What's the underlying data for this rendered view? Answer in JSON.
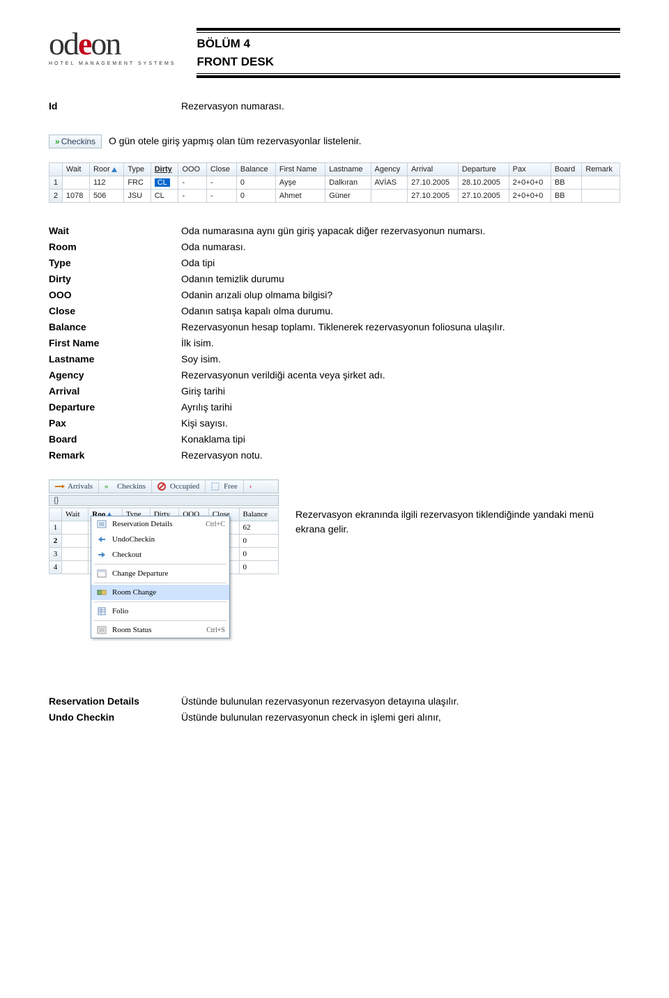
{
  "header": {
    "logo_main_pre": "od",
    "logo_main_accent": "e",
    "logo_main_post": "on",
    "logo_sub": "Hotel Management Systems",
    "section_line1": "BÖLÜM 4",
    "section_line2": "FRONT DESK"
  },
  "intro": {
    "id_term": "Id",
    "id_desc": "Rezervasyon numarası.",
    "checkins_label": "Checkins",
    "checkins_desc": "O gün otele giriş yapmış olan tüm rezervasyonlar listelenir."
  },
  "grid1": {
    "headers": [
      "",
      "Wait",
      "Roor",
      "Type",
      "Dirty",
      "OOO",
      "Close",
      "Balance",
      "First Name",
      "Lastname",
      "Agency",
      "Arrival",
      "Departure",
      "Pax",
      "Board",
      "Remark"
    ],
    "rows": [
      [
        "1",
        "",
        "112",
        "FRC",
        "CL",
        "-",
        "-",
        "0",
        "Ayşe",
        "Dalkıran",
        "AVİAS",
        "27.10.2005",
        "28.10.2005",
        "2+0+0+0",
        "BB",
        ""
      ],
      [
        "2",
        "1078",
        "506",
        "JSU",
        "CL",
        "-",
        "-",
        "0",
        "Ahmet",
        "Güner",
        "",
        "27.10.2005",
        "27.10.2005",
        "2+0+0+0",
        "BB",
        ""
      ]
    ]
  },
  "defs": [
    {
      "t": "Wait",
      "d": "Oda numarasına aynı gün giriş yapacak diğer rezervasyonun numarsı."
    },
    {
      "t": "Room",
      "d": "Oda numarası."
    },
    {
      "t": "Type",
      "d": "Oda tipi"
    },
    {
      "t": "Dirty",
      "d": "Odanın temizlik durumu"
    },
    {
      "t": "OOO",
      "d": "Odanin arızali olup olmama bilgisi?"
    },
    {
      "t": "Close",
      "d": "Odanın satışa kapalı olma durumu."
    },
    {
      "t": "Balance",
      "d": "Rezervasyonun hesap toplamı. Tiklenerek rezervasyonun foliosuna ulaşılır."
    },
    {
      "t": "First Name",
      "d": "İlk isim."
    },
    {
      "t": "Lastname",
      "d": "Soy isim."
    },
    {
      "t": "Agency",
      "d": "Rezervasyonun verildiği acenta veya şirket adı."
    },
    {
      "t": "Arrival",
      "d": "Giriş tarihi"
    },
    {
      "t": "Departure",
      "d": "Ayrılış tarihi"
    },
    {
      "t": "Pax",
      "d": "Kişi sayısı."
    },
    {
      "t": "Board",
      "d": "Konaklama tipi"
    },
    {
      "t": "Remark",
      "d": "Rezervasyon notu."
    }
  ],
  "toolbar": {
    "items": [
      "Arrivals",
      "Checkins",
      "Occupied",
      "Free"
    ]
  },
  "grid2": {
    "headers": [
      "",
      "Wait",
      "Roo",
      "Type",
      "Dirty",
      "OOO",
      "Close",
      "Balance"
    ],
    "rows": [
      [
        "1",
        "",
        "",
        "",
        "",
        "",
        "",
        "62"
      ],
      [
        "2",
        "",
        "",
        "",
        "",
        "",
        "",
        "0"
      ],
      [
        "3",
        "",
        "",
        "",
        "",
        "",
        "",
        "0"
      ],
      [
        "4",
        "",
        "",
        "",
        "",
        "",
        "",
        "0"
      ]
    ]
  },
  "ctxmenu": {
    "items": [
      {
        "label": "Reservation Details",
        "shortcut": "Ctrl+C",
        "hl": false
      },
      {
        "label": "UndoCheckin",
        "shortcut": "",
        "hl": false
      },
      {
        "label": "Checkout",
        "shortcut": "",
        "hl": false
      },
      {
        "sep": true
      },
      {
        "label": "Change Departure",
        "shortcut": "",
        "hl": false
      },
      {
        "sep": true
      },
      {
        "label": "Room Change",
        "shortcut": "",
        "hl": true
      },
      {
        "sep": true
      },
      {
        "label": "Folio",
        "shortcut": "",
        "hl": false
      },
      {
        "sep": true
      },
      {
        "label": "Room Status",
        "shortcut": "Ctrl+S",
        "hl": false
      }
    ]
  },
  "right_text": "Rezervasyon ekranında ilgili rezervasyon tiklendiğinde yandaki menü  ekrana gelir.",
  "footer": [
    {
      "t": "Reservation Details",
      "d": "Üstünde bulunulan rezervasyonun rezervasyon detayına ulaşılır."
    },
    {
      "t": "Undo Checkin",
      "d": "Üstünde bulunulan rezervasyonun check in işlemi geri alınır,"
    }
  ],
  "handle_row": "{}"
}
